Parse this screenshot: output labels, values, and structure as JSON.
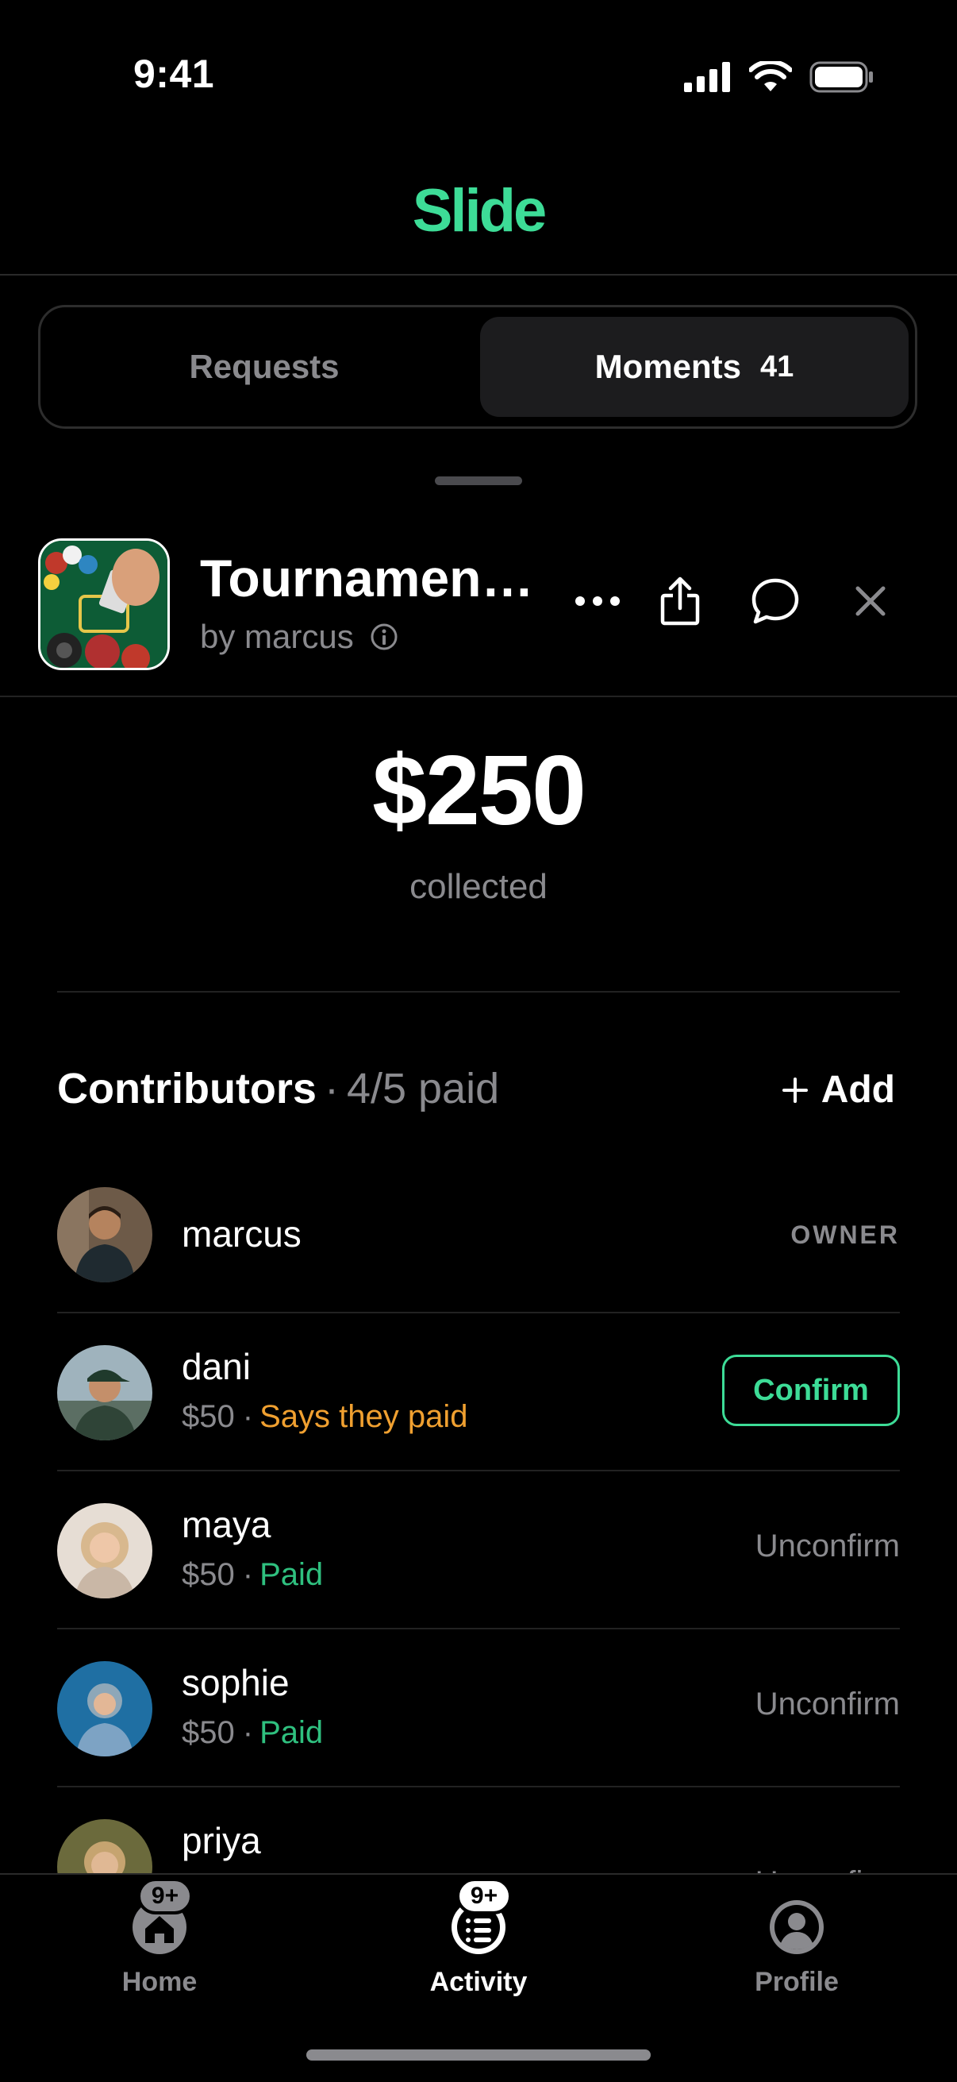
{
  "status_bar": {
    "time": "9:41"
  },
  "header": {
    "brand": "Slide"
  },
  "segments": {
    "requests": "Requests",
    "moments": "Moments",
    "moments_count": "41"
  },
  "moment": {
    "title": "Tournamen…",
    "by": "by marcus"
  },
  "collected": {
    "amount": "$250",
    "label": "collected"
  },
  "contributors": {
    "title": "Contributors",
    "separator": "·",
    "status": "4/5 paid",
    "add_label": "Add",
    "rows": [
      {
        "name": "marcus",
        "badge": "OWNER"
      },
      {
        "name": "dani",
        "amount": "$50",
        "status": "Says they paid",
        "action": "Confirm"
      },
      {
        "name": "maya",
        "amount": "$50",
        "status": "Paid",
        "action": "Unconfirm"
      },
      {
        "name": "sophie",
        "amount": "$50",
        "status": "Paid",
        "action": "Unconfirm"
      },
      {
        "name": "priya",
        "action": "Unconfirm"
      }
    ]
  },
  "tabbar": {
    "home": {
      "label": "Home",
      "badge": "9+"
    },
    "activity": {
      "label": "Activity",
      "badge": "9+"
    },
    "profile": {
      "label": "Profile"
    }
  },
  "colors": {
    "brand": "#3ddc97",
    "pending": "#f0a030",
    "paid": "#2fc07f",
    "muted": "#8a8a8e"
  }
}
